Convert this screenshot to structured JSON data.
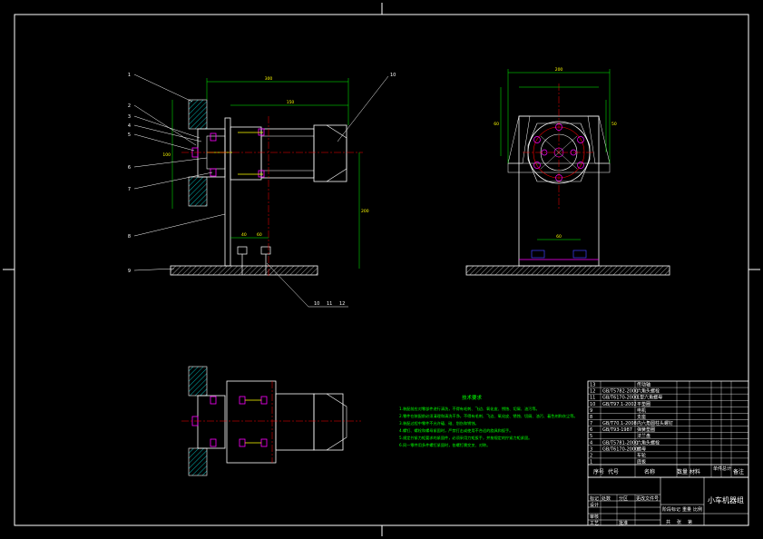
{
  "drawing": {
    "title_block_name": "小车机器组",
    "tech_req_title": "技术要求",
    "tech_req_lines": [
      "1.装配前应对零部件进行清洗，不得有毛刺、飞边、氧化皮、锈蚀、切屑、油污等。",
      "2.零件在装配前必须清理和清洗干净，不得有毛刺、飞边、氧化皮、锈蚀、切屑、油污、着色剂和灰尘等。",
      "3.装配过程中零件不允许磕、碰、划伤和锈蚀。",
      "4.螺钉、螺栓和螺母紧固时，严禁打击或使用不合适的旋具和扳手。",
      "5.规定拧紧力矩要求的紧固件，必须采用力矩扳手，并按规定的拧紧力矩紧固。",
      "6.同一零件用多件螺钉紧固时，各螺钉需交叉、对称。"
    ]
  },
  "bom_header": [
    "序号",
    "代号",
    "名称",
    "数量",
    "材料",
    "单件",
    "总计",
    "备注"
  ],
  "bom_rows": [
    {
      "no": "13",
      "code": "",
      "name": "传动轴"
    },
    {
      "no": "12",
      "code": "GB/T5782-2000",
      "name": "六角头螺栓"
    },
    {
      "no": "11",
      "code": "GB/T6170-2000",
      "name": "1型六角螺母"
    },
    {
      "no": "10",
      "code": "GB/T97.1-2002",
      "name": "平垫圈"
    },
    {
      "no": "9",
      "code": "",
      "name": "电机"
    },
    {
      "no": "8",
      "code": "",
      "name": "支座"
    },
    {
      "no": "7",
      "code": "GB/T70.1-2008",
      "name": "内六角圆柱头螺钉"
    },
    {
      "no": "6",
      "code": "GB/T93-1987",
      "name": "弹簧垫圈"
    },
    {
      "no": "5",
      "code": "",
      "name": "法兰盘"
    },
    {
      "no": "4",
      "code": "GB/T5781-2000",
      "name": "六角头螺栓"
    },
    {
      "no": "3",
      "code": "GB/T6170-2000",
      "name": "螺母"
    },
    {
      "no": "2",
      "code": "",
      "name": "车轮"
    },
    {
      "no": "1",
      "code": "",
      "name": "底板"
    }
  ],
  "title_block_labels": [
    "标记",
    "处数",
    "分区",
    "更改文件号",
    "签名",
    "年月日",
    "设计",
    "审核",
    "工艺",
    "批准",
    "阶段标记",
    "重量",
    "比例",
    "共",
    "张",
    "第"
  ],
  "part_numbers_left": [
    "1",
    "2",
    "3",
    "4",
    "5",
    "6",
    "7",
    "8",
    "9"
  ],
  "part_numbers_top": [
    "10"
  ],
  "part_numbers_bottom": [
    "10",
    "11",
    "12"
  ],
  "dimensions": {
    "front_top_outer": "300",
    "front_top_inner": "150",
    "front_left": "100",
    "front_right_height": "200",
    "front_bottom_a": "40",
    "front_bottom_b": "60",
    "side_top": "200",
    "side_left": "60",
    "side_right": "50",
    "side_bottom": "60"
  },
  "colors": {
    "line_white": "#ffffff",
    "line_yellow": "#ffff00",
    "center_red": "#ff0000",
    "dim_green": "#00ff00",
    "hatch_cyan": "#00ffff",
    "bolt_magenta": "#ff00ff",
    "bolt_blue": "#4040ff"
  }
}
